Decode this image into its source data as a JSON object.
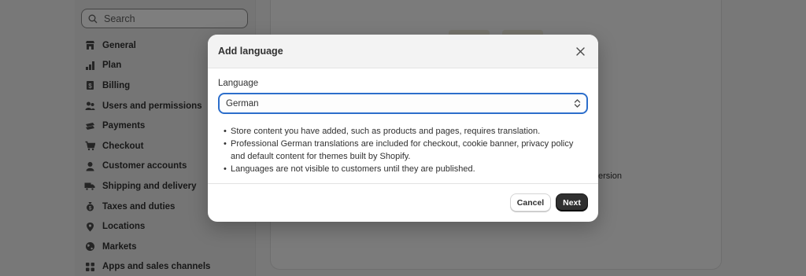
{
  "sidebar": {
    "search_placeholder": "Search",
    "items": [
      {
        "label": "General",
        "icon": "store-icon"
      },
      {
        "label": "Plan",
        "icon": "plan-icon"
      },
      {
        "label": "Billing",
        "icon": "billing-icon"
      },
      {
        "label": "Users and permissions",
        "icon": "users-icon"
      },
      {
        "label": "Payments",
        "icon": "payments-icon"
      },
      {
        "label": "Checkout",
        "icon": "cart-icon"
      },
      {
        "label": "Customer accounts",
        "icon": "person-icon"
      },
      {
        "label": "Shipping and delivery",
        "icon": "truck-icon"
      },
      {
        "label": "Taxes and duties",
        "icon": "tax-icon"
      },
      {
        "label": "Locations",
        "icon": "location-icon"
      },
      {
        "label": "Markets",
        "icon": "globe-icon"
      },
      {
        "label": "Apps and sales channels",
        "icon": "apps-icon"
      }
    ]
  },
  "background": {
    "fragment_text": "ersion"
  },
  "modal": {
    "title": "Add language",
    "field_label": "Language",
    "selected_language": "German",
    "notes": [
      "Store content you have added, such as products and pages, requires translation.",
      "Professional German translations are included for checkout, cookie banner, privacy policy and default content for themes built by Shopify.",
      "Languages are not visible to customers until they are published."
    ],
    "cancel_label": "Cancel",
    "next_label": "Next"
  },
  "colors": {
    "focus_ring": "#2c6ecb",
    "primary_button": "#303030",
    "overlay": "rgba(0,0,0,0.5)"
  }
}
